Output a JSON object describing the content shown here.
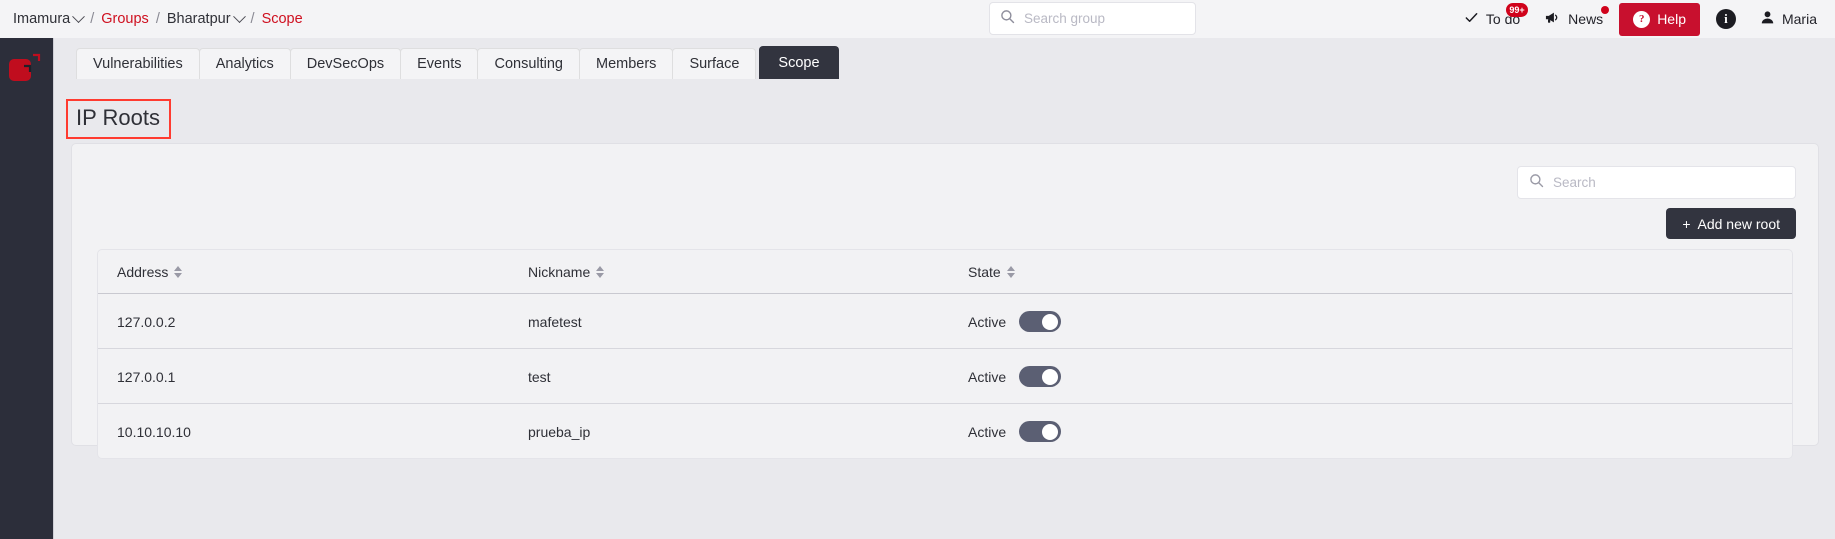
{
  "header": {
    "breadcrumb": [
      {
        "label": "Imamura",
        "caret": true,
        "link": false
      },
      {
        "label": "Groups",
        "caret": false,
        "link": true
      },
      {
        "label": "Bharatpur",
        "caret": true,
        "link": false
      },
      {
        "label": "Scope",
        "caret": false,
        "link": true
      }
    ],
    "separator": "/",
    "group_search_placeholder": "Search group",
    "group_search_value": "",
    "todo_label": "To do",
    "todo_badge": "99+",
    "news_label": "News",
    "help_label": "Help",
    "help_glyph": "?",
    "info_glyph": "i",
    "user_name": "Maria",
    "accent_red": "#c8102e",
    "badge_red": "#d0021b"
  },
  "tabs": [
    {
      "label": "Vulnerabilities",
      "active": false
    },
    {
      "label": "Analytics",
      "active": false
    },
    {
      "label": "DevSecOps",
      "active": false
    },
    {
      "label": "Events",
      "active": false
    },
    {
      "label": "Consulting",
      "active": false
    },
    {
      "label": "Members",
      "active": false
    },
    {
      "label": "Surface",
      "active": false
    },
    {
      "label": "Scope",
      "active": true
    }
  ],
  "page": {
    "title": "IP Roots",
    "title_highlight_color": "#ff3b30"
  },
  "toolbar": {
    "search_placeholder": "Search",
    "search_value": "",
    "add_button_label": "Add new root",
    "add_button_icon": "+"
  },
  "table": {
    "columns": [
      {
        "label": "Address",
        "sortable": true
      },
      {
        "label": "Nickname",
        "sortable": true
      },
      {
        "label": "State",
        "sortable": true
      }
    ],
    "rows": [
      {
        "address": "127.0.0.2",
        "nickname": "mafetest",
        "state_label": "Active",
        "state_on": true
      },
      {
        "address": "127.0.0.1",
        "nickname": "test",
        "state_label": "Active",
        "state_on": true
      },
      {
        "address": "10.10.10.10",
        "nickname": "prueba_ip",
        "state_label": "Active",
        "state_on": true
      }
    ]
  }
}
